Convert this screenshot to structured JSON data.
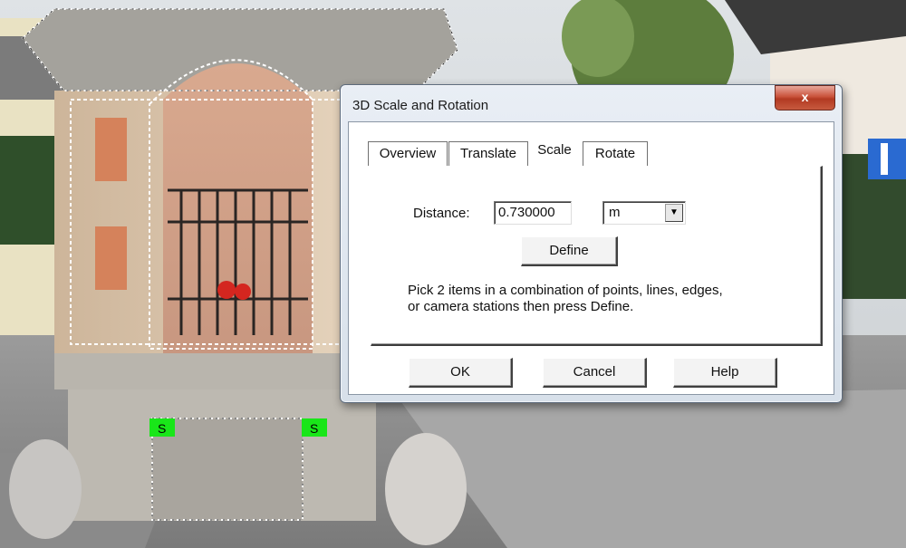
{
  "dialog": {
    "title": "3D Scale and Rotation",
    "close_icon": "close-icon",
    "close_glyph": "x",
    "tabs": [
      {
        "label": "Overview",
        "active": false
      },
      {
        "label": "Translate",
        "active": false
      },
      {
        "label": "Scale",
        "active": true
      },
      {
        "label": "Rotate",
        "active": false
      }
    ],
    "distance_label": "Distance:",
    "distance_value": "0.730000",
    "unit_value": "m",
    "dropdown_icon": "chevron-down-icon",
    "define_label": "Define",
    "hint_line1": "Pick 2 items in a combination of points, lines, edges,",
    "hint_line2": "or camera stations then press Define.",
    "ok_label": "OK",
    "cancel_label": "Cancel",
    "help_label": "Help"
  },
  "photo": {
    "marker_left": "S",
    "marker_right": "S",
    "marker_color": "#19e619"
  }
}
